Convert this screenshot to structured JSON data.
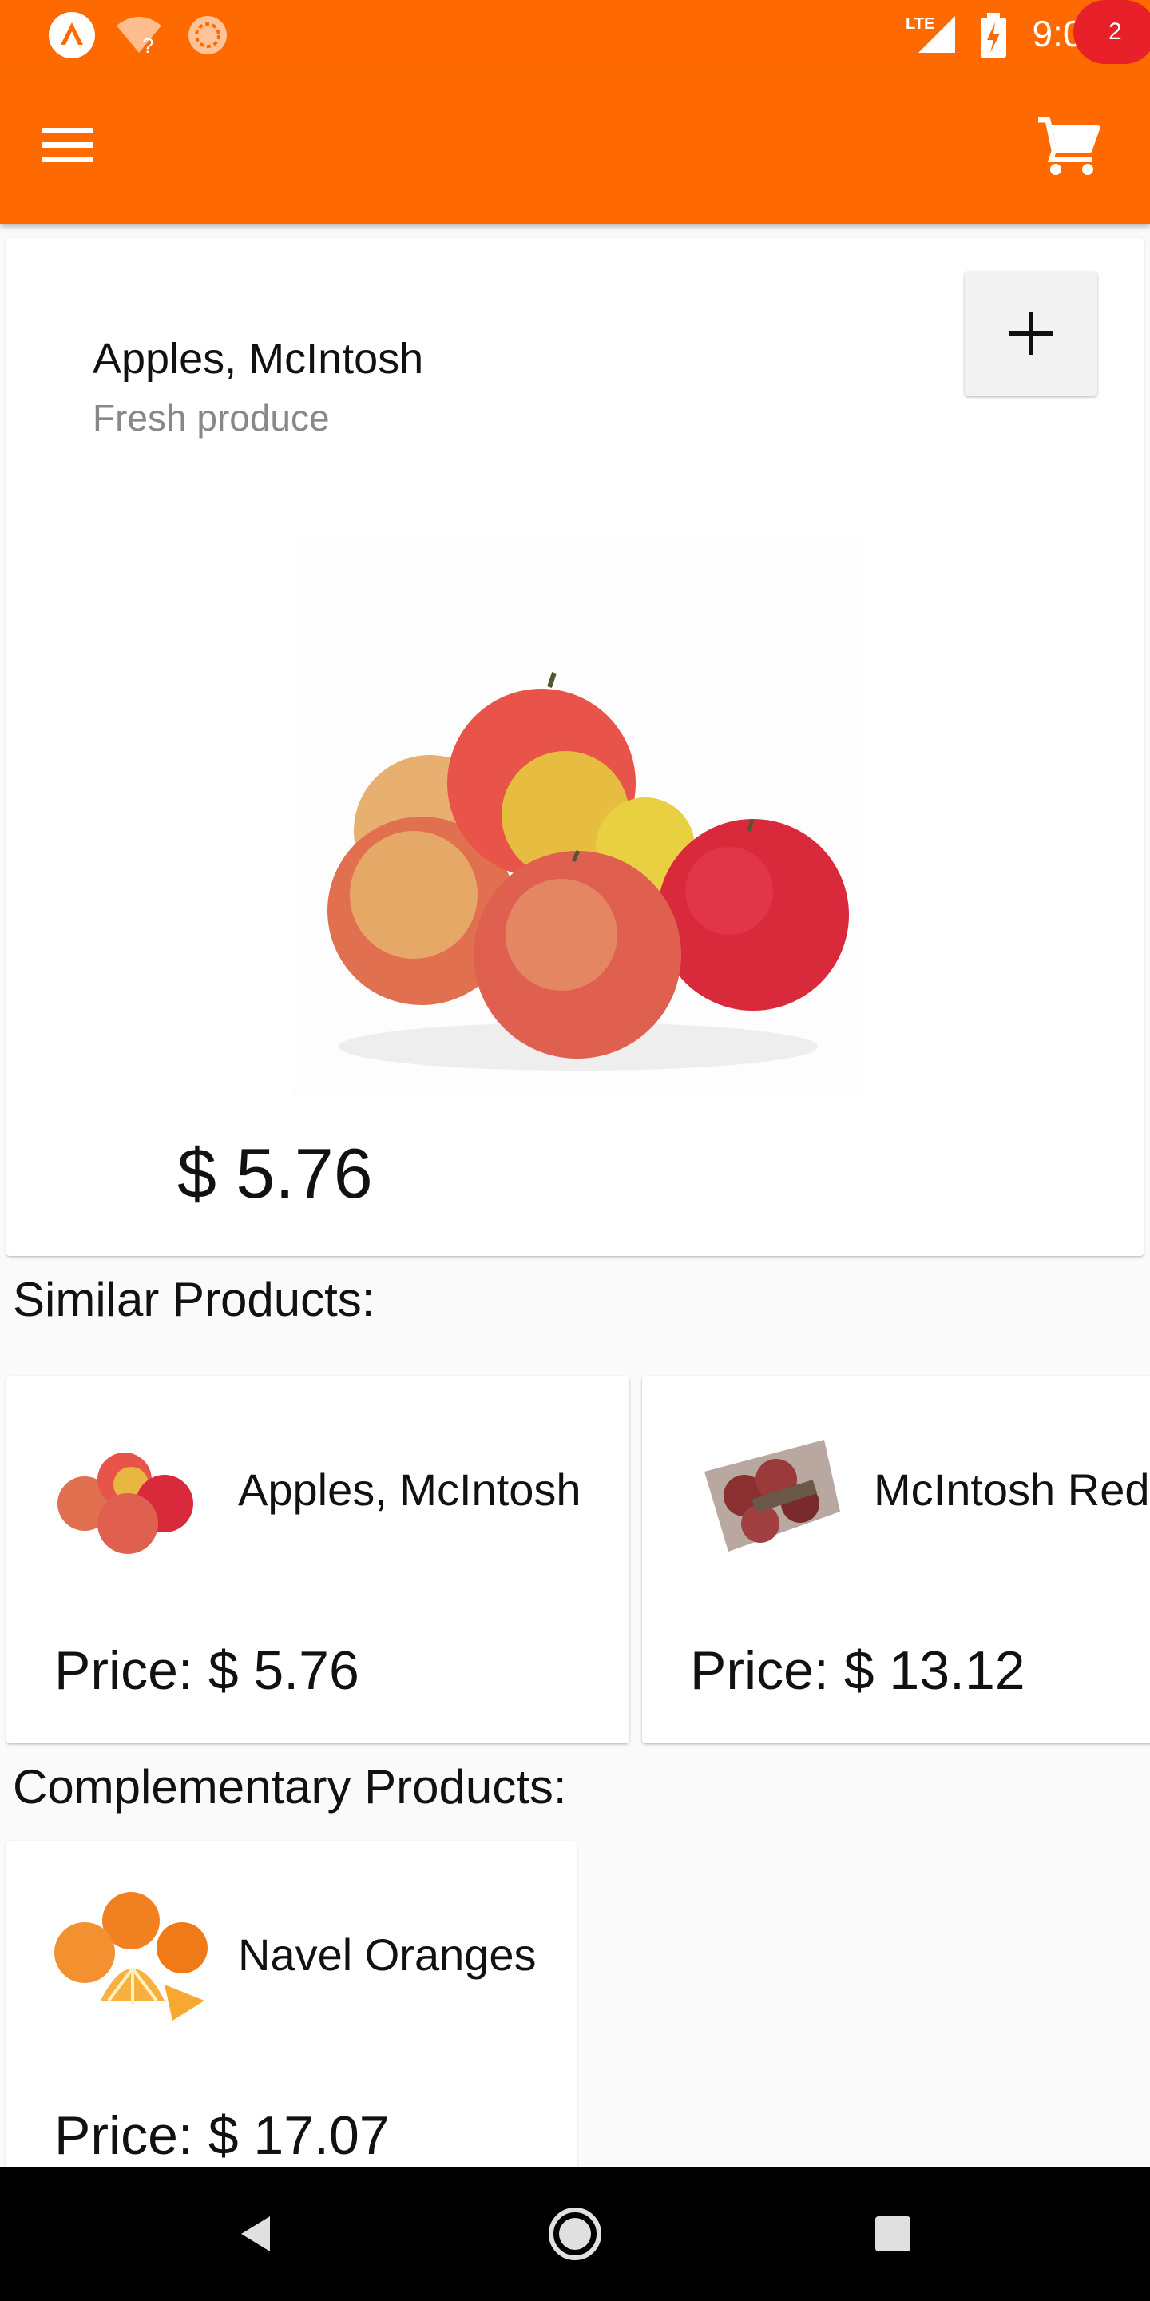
{
  "status_bar": {
    "time": "9:07",
    "network": "LTE",
    "icons": [
      "app-logo-icon",
      "wifi-unknown-icon",
      "sync-icon",
      "lte-signal-icon",
      "battery-charging-icon"
    ]
  },
  "app_bar": {
    "menu_icon": "hamburger-menu-icon",
    "cart_icon": "shopping-cart-icon",
    "cart_count": "2",
    "colors": {
      "primary": "#ff6a00",
      "badge": "#e8202a"
    }
  },
  "product": {
    "name": "Apples, McIntosh",
    "category": "Fresh produce",
    "price": "$ 5.76",
    "add_icon": "plus-icon"
  },
  "similar": {
    "title": "Similar Products:",
    "items": [
      {
        "name": "Apples, McIntosh",
        "price": "Price: $ 5.76"
      },
      {
        "name": "McIntosh Red",
        "price": "Price: $ 13.12"
      }
    ]
  },
  "complementary": {
    "title": "Complementary Products:",
    "items": [
      {
        "name": "Navel Oranges",
        "price": "Price: $ 17.07"
      }
    ]
  },
  "nav_bar": {
    "icons": [
      "back-icon",
      "home-icon",
      "recents-icon"
    ]
  }
}
